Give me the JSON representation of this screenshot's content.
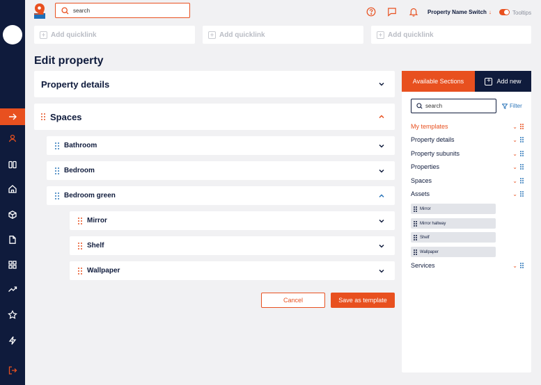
{
  "header": {
    "search_placeholder": "search",
    "property_switch": "Property Name Switch",
    "tooltips_label": "Tooltips"
  },
  "quicklinks": [
    "Add quicklink",
    "Add quicklink",
    "Add quicklink"
  ],
  "page_title": "Edit property",
  "sections": {
    "property_details": "Property details",
    "spaces": "Spaces",
    "bathroom": "Bathroom",
    "bedroom": "Bedroom",
    "bedroom_green": "Bedroom green",
    "mirror": "Mirror",
    "shelf": "Shelf",
    "wallpaper": "Wallpaper"
  },
  "actions": {
    "cancel": "Cancel",
    "save_template": "Save as template"
  },
  "right_panel": {
    "tab_available": "Available Sections",
    "tab_add_new": "Add new",
    "search_placeholder": "search",
    "filter_label": "Filter",
    "items": [
      {
        "label": "My templates"
      },
      {
        "label": "Property details"
      },
      {
        "label": "Property subunits"
      },
      {
        "label": "Properties"
      },
      {
        "label": "Spaces"
      },
      {
        "label": "Assets"
      }
    ],
    "asset_chips": [
      "Mirror",
      "Mirror hallway",
      "Shelf",
      "Wallpaper"
    ],
    "services": "Services"
  },
  "colors": {
    "accent": "#e8501f",
    "navy": "#0f1b3c",
    "blue": "#2a74b8"
  }
}
